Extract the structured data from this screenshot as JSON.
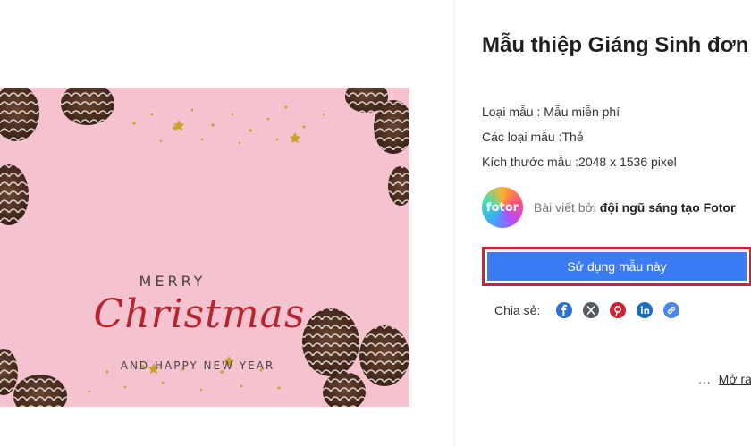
{
  "card": {
    "line1": "MERRY",
    "line2": "Christmas",
    "line3": "AND HAPPY NEW YEAR"
  },
  "template": {
    "title": "Mẫu thiệp Giáng Sinh đơn giản màu hồng",
    "type_line": "Loại mẫu : Mẫu miễn phí",
    "category_line": "Các loại mẫu :Thẻ",
    "size_line": "Kích thước mẫu :2048 x 1536 pixel"
  },
  "author": {
    "avatar_text": "fotor",
    "prefix": "Bài viết bởi",
    "name": "đội ngũ sáng tạo Fotor"
  },
  "use_button": "Sử dụng mẫu này",
  "share": {
    "label": "Chia sẻ:",
    "icons": [
      "facebook-icon",
      "x-icon",
      "pinterest-icon",
      "linkedin-icon",
      "link-icon"
    ]
  },
  "more": {
    "dots": "...",
    "label": "Mở ra"
  },
  "colors": {
    "card_background": "#f5c3cf",
    "christmas_red": "#b4252f",
    "button_blue": "#3b7cf5",
    "highlight_red": "#d32030"
  }
}
